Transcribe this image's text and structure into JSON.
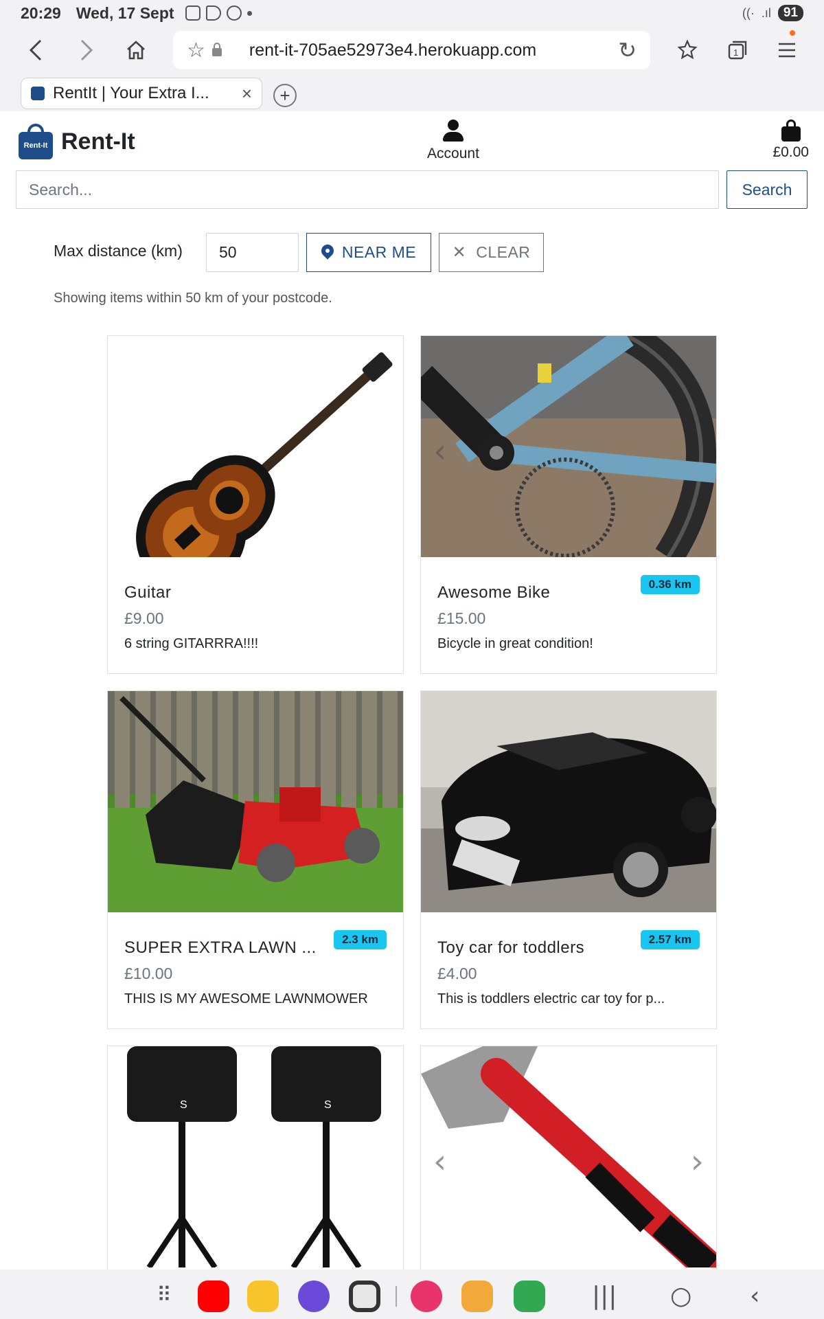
{
  "status_bar": {
    "time": "20:29",
    "date": "Wed, 17 Sept",
    "battery": "91"
  },
  "browser": {
    "url": "rent-it-705ae52973e4.herokuapp.com",
    "tab_title": "RentIt | Your Extra I...",
    "tab_close": "×",
    "new_tab": "+"
  },
  "header": {
    "logo_badge": "Rent-It",
    "brand": "Rent-It",
    "account_label": "Account",
    "cart_total": "£0.00"
  },
  "search": {
    "placeholder": "Search...",
    "button_label": "Search"
  },
  "distance_filter": {
    "label": "Max distance (km)",
    "value": "50",
    "near_me_label": "NEAR ME",
    "clear_label": "CLEAR",
    "summary": "Showing items within 50 km of your postcode."
  },
  "products": [
    {
      "title": "Guitar",
      "price": "£9.00",
      "description": "6 string GITARRRA!!!!",
      "distance": ""
    },
    {
      "title": "Awesome Bike",
      "price": "£15.00",
      "description": "Bicycle in great condition!",
      "distance": "0.36 km"
    },
    {
      "title": "SUPER EXTRA LAWN ...",
      "price": "£10.00",
      "description": "THIS IS MY AWESOME LAWNMOWER",
      "distance": "2.3 km"
    },
    {
      "title": "Toy car for toddlers",
      "price": "£4.00",
      "description": "This is toddlers electric car toy for p...",
      "distance": "2.57 km"
    }
  ],
  "colors": {
    "brand_blue": "#1d4e89",
    "badge_cyan": "#18c6ef"
  }
}
